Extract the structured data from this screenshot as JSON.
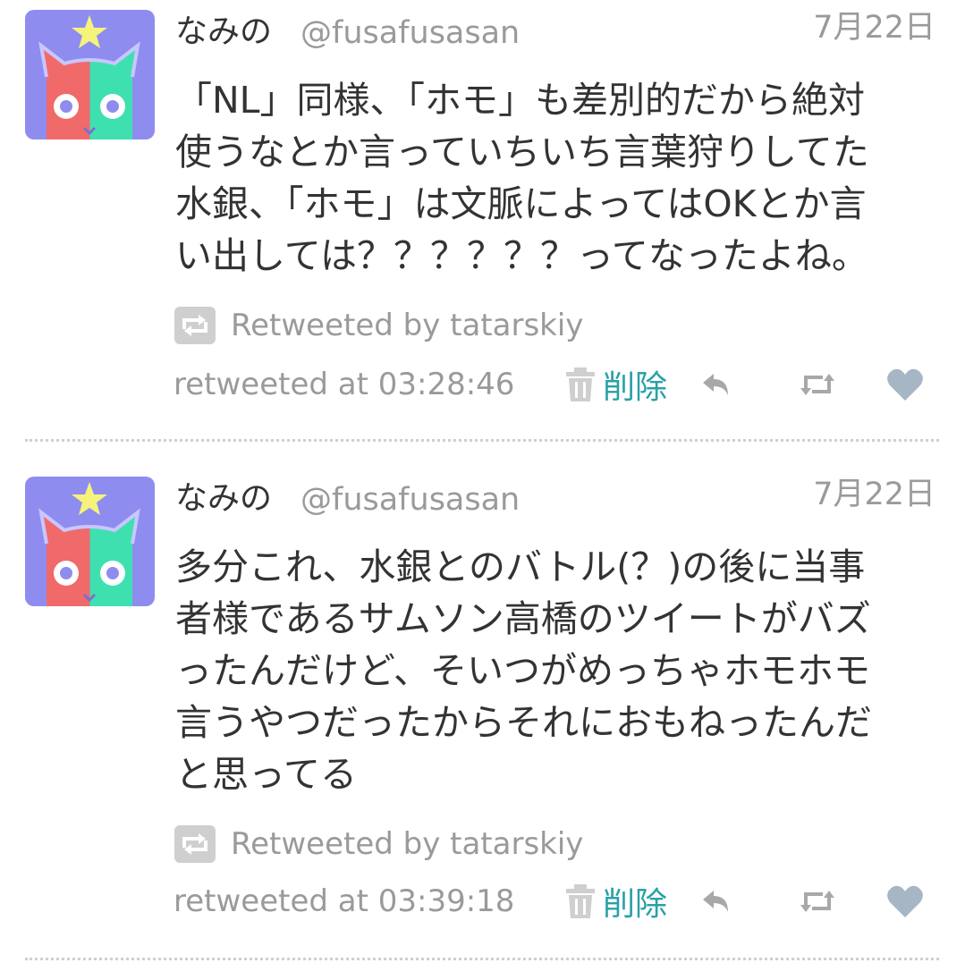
{
  "tweets": [
    {
      "name": "なみの",
      "handle": "@fusafusasan",
      "date": "7月22日",
      "text": "「NL」同様、「ホモ」も差別的だから絶対\n使うなとか言っていちいち言葉狩りしてた\n水銀、「ホモ」は文脈によってはOKとか言\nい出しては？？？？？？ってなったよね。",
      "retweeted_by": "Retweeted by tatarskiy",
      "retweeted_at": "retweeted at 03:28:46",
      "delete_label": "削除"
    },
    {
      "name": "なみの",
      "handle": "@fusafusasan",
      "date": "7月22日",
      "text": "多分これ、水銀とのバトル(？)の後に当事\n者様であるサムソン高橋のツイートがバズ\nったんだけど、そいつがめっちゃホモホモ\n言うやつだったからそれにおもねったんだ\nと思ってる",
      "retweeted_by": "Retweeted by tatarskiy",
      "retweeted_at": "retweeted at 03:39:18",
      "delete_label": "削除"
    }
  ],
  "icons": {
    "avatar": "cat-avatar-icon",
    "retweet_badge": "retweet-badge-icon",
    "trash": "trash-icon",
    "reply": "reply-icon",
    "retweet": "retweet-icon",
    "like": "heart-icon"
  },
  "colors": {
    "avatar_bg": "#8f8cf0",
    "cat_left": "#f06a6a",
    "cat_right": "#3fe0b0",
    "star": "#f5f37a",
    "delete_accent": "#2aa0a8",
    "heart": "#a6b6c4",
    "muted_text": "#9a9a9a"
  }
}
